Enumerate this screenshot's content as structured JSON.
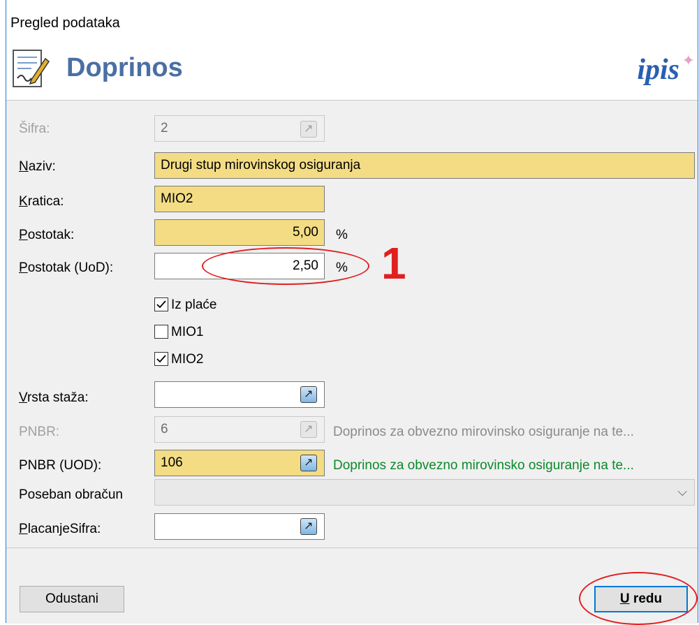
{
  "window": {
    "title": "Pregled podataka"
  },
  "header": {
    "title": "Doprinos",
    "logo": "ipis"
  },
  "fields": {
    "sifra": {
      "label": "Šifra:",
      "value": "2"
    },
    "naziv": {
      "label": "Naziv:",
      "value": "Drugi stup mirovinskog osiguranja"
    },
    "kratica": {
      "label": "Kratica:",
      "value": "MIO2"
    },
    "postotak": {
      "label": "Postotak:",
      "value": "5,00",
      "unit": "%"
    },
    "postotak_uod": {
      "label": "Postotak (UoD):",
      "value": "2,50",
      "unit": "%"
    },
    "vrsta_staza": {
      "label": "Vrsta staža:",
      "value": ""
    },
    "pnbr": {
      "label": "PNBR:",
      "value": "6",
      "description": "Doprinos za obvezno mirovinsko osiguranje na te..."
    },
    "pnbr_uod": {
      "label": "PNBR (UOD):",
      "value": "106",
      "description": "Doprinos za obvezno mirovinsko osiguranje na te..."
    },
    "poseban_obracun": {
      "label": "Poseban obračun",
      "value": ""
    },
    "placanje_sifra": {
      "label": "PlacanjeSifra:",
      "value": ""
    }
  },
  "checkboxes": [
    {
      "label": "Iz plaće",
      "checked": true
    },
    {
      "label": "MIO1",
      "checked": false
    },
    {
      "label": "MIO2",
      "checked": true
    }
  ],
  "annotation": {
    "number": "1",
    "color": "#e02020"
  },
  "buttons": {
    "cancel": "Odustani",
    "ok": "U redu"
  },
  "colors": {
    "required_field": "#f3dc84",
    "accent": "#0078d7",
    "header_title": "#4a6fa5",
    "description_green": "#0a8a2a"
  }
}
